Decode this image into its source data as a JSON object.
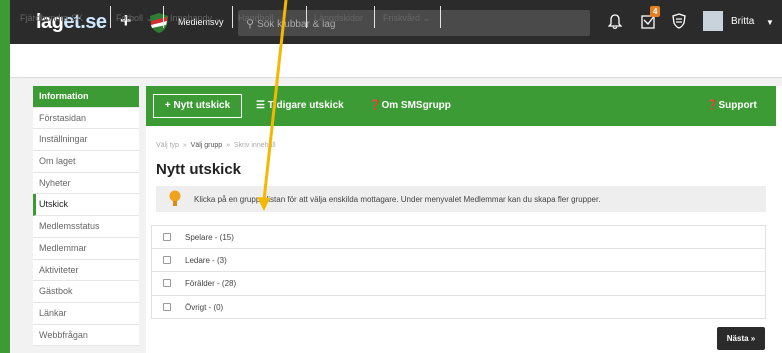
{
  "brand": {
    "logo_part1": "lag",
    "logo_part2": "et.se"
  },
  "topbar": {
    "add_icon": "plus-icon",
    "club_label": "Medlemsvy",
    "search_placeholder": "Sök klubbar & lag",
    "notifications_badge": "4",
    "user_name": "Britta"
  },
  "sports": [
    "Fjärdhundra SK",
    "Fotboll",
    "Innebandy",
    "Handboll",
    "Längdskidor",
    "Friskvård"
  ],
  "sidebar": {
    "header": "Information",
    "items": [
      "Förstasidan",
      "Inställningar",
      "Om laget",
      "Nyheter",
      "Utskick",
      "Medlemsstatus",
      "Medlemmar",
      "Aktiviteter",
      "Gästbok",
      "Länkar",
      "Webbfrågan"
    ]
  },
  "toolbar": {
    "new_label": "Nytt utskick",
    "previous_label": "Tidigare utskick",
    "about_label": "Om SMSgrupp",
    "support_label": "Support"
  },
  "breadcrumb": {
    "step1": "Välj typ",
    "step2": "Välj grupp",
    "step3": "Skriv innehåll"
  },
  "page_title": "Nytt utskick",
  "info_text": "Klicka på en grupp i listan för att välja enskilda mottagare. Under menyvalet Medlemmar kan du skapa fler grupper.",
  "groups": [
    "Spelare - (15)",
    "Ledare - (3)",
    "Förälder - (28)",
    "Övrigt - (0)"
  ],
  "next_label": "Nästa »",
  "colors": {
    "brand_green": "#3d9b35",
    "dark": "#2b2b2b",
    "annotation": "#f5b800"
  }
}
